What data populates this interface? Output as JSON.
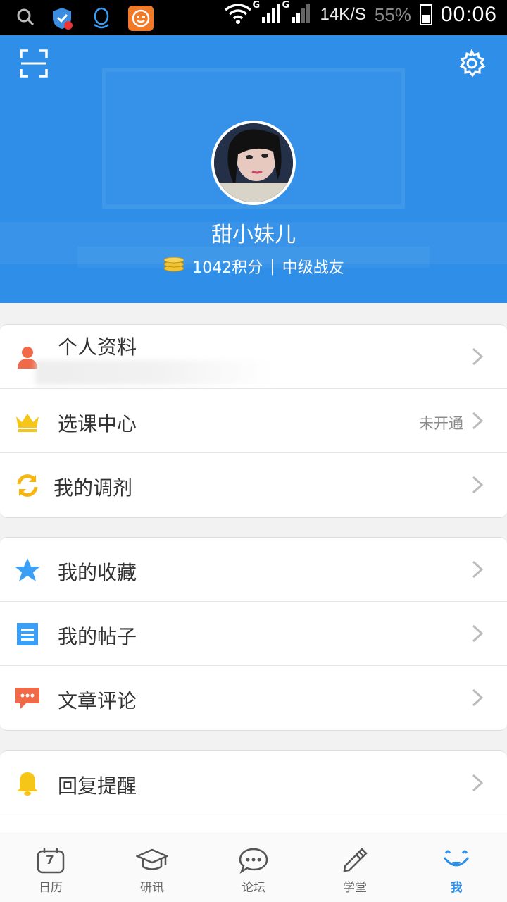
{
  "status_bar": {
    "speed": "14K/S",
    "battery": "55%",
    "time": "00:06",
    "network_g1": "G",
    "network_g2": "G"
  },
  "header": {
    "username": "甜小妹儿",
    "points": "1042积分",
    "separator": "|",
    "level": "中级战友",
    "bg_color": "#2f8fe8"
  },
  "menu": {
    "group1": [
      {
        "label": "个人资料",
        "status": "",
        "icon": "person-icon"
      },
      {
        "label": "选课中心",
        "status": "未开通",
        "icon": "crown-icon"
      },
      {
        "label": "我的调剂",
        "status": "",
        "icon": "refresh-icon"
      }
    ],
    "group2": [
      {
        "label": "我的收藏",
        "status": "",
        "icon": "star-icon"
      },
      {
        "label": "我的帖子",
        "status": "",
        "icon": "document-icon"
      },
      {
        "label": "文章评论",
        "status": "",
        "icon": "comment-icon"
      }
    ],
    "group3": [
      {
        "label": "回复提醒",
        "status": "",
        "icon": "bell-icon"
      }
    ]
  },
  "tabbar": {
    "tabs": [
      {
        "label": "日历",
        "icon": "calendar-icon",
        "badge": "7"
      },
      {
        "label": "研讯",
        "icon": "graduation-cap-icon"
      },
      {
        "label": "论坛",
        "icon": "chat-bubble-icon"
      },
      {
        "label": "学堂",
        "icon": "pencil-icon"
      },
      {
        "label": "我",
        "icon": "smile-icon"
      }
    ],
    "active_index": 4
  }
}
